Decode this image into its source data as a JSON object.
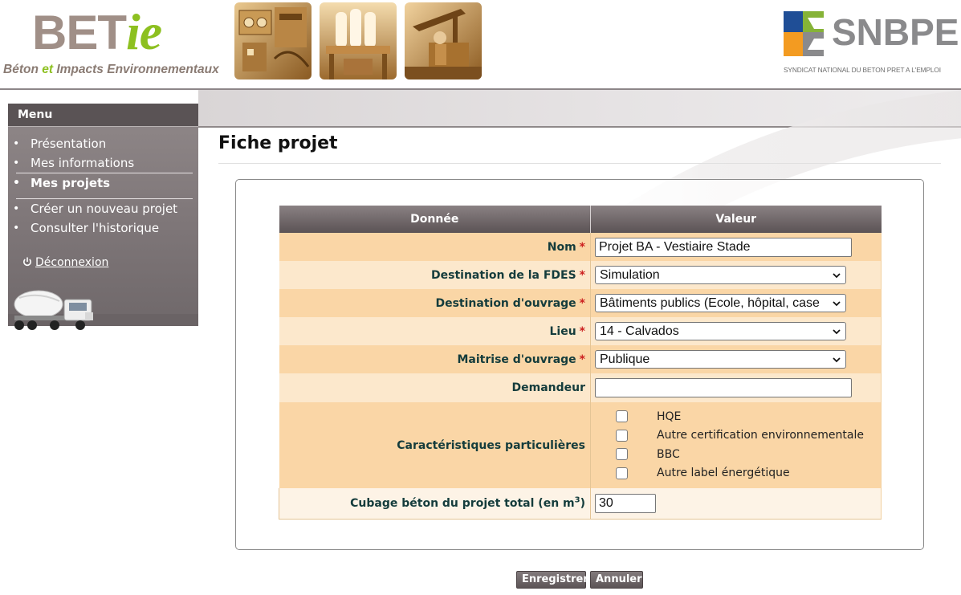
{
  "header": {
    "logo_betie": {
      "word_part1": "BET",
      "word_part2": "ie",
      "tagline_part1": "Béton",
      "tagline_part2": "et",
      "tagline_part3": "Impacts Environnementaux"
    },
    "logo_snbpe": {
      "word": "SNBPE",
      "subtitle": "SYNDICAT NATIONAL DU BETON PRET A L'EMPLOI"
    },
    "photos": [
      "lab-equipment-photo",
      "concrete-plant-photo",
      "concrete-pump-photo"
    ]
  },
  "sidebar": {
    "title": "Menu",
    "items": [
      {
        "label": "Présentation",
        "active": false
      },
      {
        "label": "Mes informations",
        "active": false
      },
      {
        "label": "Mes projets",
        "active": true
      },
      {
        "label": "Créer un nouveau projet",
        "active": false
      },
      {
        "label": "Consulter l'historique",
        "active": false
      }
    ],
    "logout_label": "Déconnexion"
  },
  "main": {
    "title": "Fiche projet",
    "table": {
      "headers": [
        "Donnée",
        "Valeur"
      ],
      "fields": {
        "nom": {
          "label": "Nom",
          "required": true,
          "value": "Projet BA - Vestiaire Stade"
        },
        "destination_fdes": {
          "label": "Destination de la FDES",
          "required": true,
          "value": "Simulation"
        },
        "destination_ouvrage": {
          "label": "Destination d'ouvrage",
          "required": true,
          "value": "Bâtiments publics (Ecole, hôpital, case"
        },
        "lieu": {
          "label": "Lieu",
          "required": true,
          "value": "14 - Calvados"
        },
        "maitrise_ouvrage": {
          "label": "Maitrise d'ouvrage",
          "required": true,
          "value": "Publique"
        },
        "demandeur": {
          "label": "Demandeur",
          "required": false,
          "value": ""
        },
        "caracteristiques": {
          "label": "Caractéristiques particulières",
          "options": [
            {
              "label": "HQE",
              "checked": false
            },
            {
              "label": "Autre certification environnementale",
              "checked": false
            },
            {
              "label": "BBC",
              "checked": false
            },
            {
              "label": "Autre label énergétique",
              "checked": false
            }
          ]
        },
        "cubage": {
          "label_main": "Cubage béton du projet total (en m",
          "label_sup": "3",
          "label_end": ")",
          "value": "30"
        }
      },
      "required_marker": "*"
    },
    "buttons": {
      "save": "Enregistrer",
      "cancel": "Annuler"
    }
  },
  "colors": {
    "header_band": "#d9d5d6",
    "menu_bg": "#7e7678",
    "row_dark": "#fad6a6",
    "row_light": "#fce8cc",
    "label_text": "#143c3c",
    "required": "#cc1f1f",
    "betie_green": "#8dc020",
    "snbpe_orange": "#f39b21",
    "snbpe_blue": "#1f4e96",
    "snbpe_green": "#86b337"
  }
}
